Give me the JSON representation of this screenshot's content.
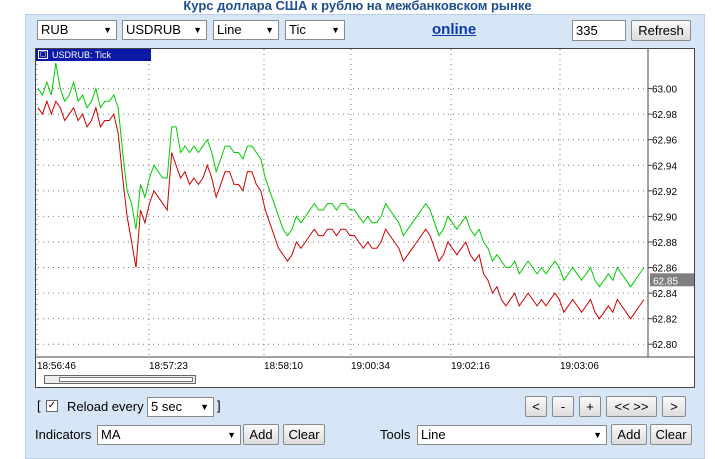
{
  "page_title": "Курс доллара США к рублю на межбанковском рынке",
  "toolbar": {
    "currency": "RUB",
    "pair": "USDRUB",
    "chart_type": "Line",
    "interval": "Tic",
    "online_label": "online",
    "count_value": "335",
    "refresh_label": "Refresh"
  },
  "chart_header": "USDRUB: Tick",
  "current_price_label": "62.85",
  "chart_data": {
    "type": "line",
    "title": "USDRUB: Tick",
    "x_tick_labels": [
      "18:56:46",
      "18:57:23",
      "18:58:10",
      "19:00:34",
      "19:02:16",
      "19:03:06"
    ],
    "y_tick_labels": [
      "63.00",
      "62.98",
      "62.96",
      "62.94",
      "62.92",
      "62.90",
      "62.88",
      "62.86",
      "62.84",
      "62.82",
      "62.80"
    ],
    "ylim": [
      62.79,
      63.02
    ],
    "current_value": 62.85,
    "grid": true,
    "colors": {
      "ask": "#00cc00",
      "bid": "#cc0000",
      "spike": "#5a6a00"
    },
    "series": [
      {
        "values": [
          63.0,
          62.995,
          63.005,
          62.995,
          63.02,
          63.0,
          62.99,
          62.995,
          63.005,
          62.99,
          62.995,
          62.985,
          62.99,
          63.0,
          62.985,
          62.99,
          62.99,
          62.995,
          62.985,
          62.95,
          62.92,
          62.91,
          62.89,
          62.925,
          62.915,
          62.93,
          62.94,
          62.935,
          62.93,
          62.93,
          62.97,
          62.97,
          62.95,
          62.955,
          62.95,
          62.955,
          62.95,
          62.955,
          62.96,
          62.95,
          62.935,
          62.945,
          62.955,
          62.955,
          62.95,
          62.95,
          62.945,
          62.955,
          62.955,
          62.95,
          62.945,
          62.93,
          62.92,
          62.91,
          62.9,
          62.89,
          62.885,
          62.89,
          62.9,
          62.895,
          62.9,
          62.905,
          62.91,
          62.905,
          62.905,
          62.91,
          62.91,
          62.905,
          62.91,
          62.91,
          62.905,
          62.905,
          62.9,
          62.895,
          62.9,
          62.895,
          62.895,
          62.9,
          62.91,
          62.905,
          62.9,
          62.895,
          62.885,
          62.89,
          62.895,
          62.9,
          62.905,
          62.91,
          62.905,
          62.895,
          62.885,
          62.89,
          62.9,
          62.895,
          62.89,
          62.895,
          62.9,
          62.89,
          62.885,
          62.89,
          62.88,
          62.875,
          62.865,
          62.87,
          62.865,
          62.86,
          62.86,
          62.865,
          62.855,
          62.86,
          62.865,
          62.86,
          62.855,
          62.86,
          62.855,
          62.86,
          62.865,
          62.86,
          62.85,
          62.855,
          62.86,
          62.855,
          62.85,
          62.855,
          62.86,
          62.85,
          62.845,
          62.85,
          62.855,
          62.85,
          62.86,
          62.855,
          62.85,
          62.845,
          62.85,
          62.855,
          62.86
        ]
      },
      {
        "values": [
          62.985,
          62.98,
          62.99,
          62.98,
          62.99,
          62.985,
          62.975,
          62.98,
          62.985,
          62.975,
          62.98,
          62.97,
          62.975,
          62.985,
          62.97,
          62.975,
          62.975,
          62.98,
          62.965,
          62.93,
          62.9,
          62.88,
          62.86,
          62.905,
          62.895,
          62.91,
          62.92,
          62.915,
          62.91,
          62.905,
          62.95,
          62.94,
          62.93,
          62.935,
          62.925,
          62.93,
          62.925,
          62.93,
          62.94,
          62.93,
          62.915,
          62.925,
          62.935,
          62.935,
          62.925,
          62.925,
          62.92,
          62.935,
          62.935,
          62.925,
          62.92,
          62.905,
          62.895,
          62.885,
          62.875,
          62.87,
          62.865,
          62.87,
          62.88,
          62.875,
          62.88,
          62.885,
          62.89,
          62.885,
          62.885,
          62.89,
          62.89,
          62.885,
          62.89,
          62.89,
          62.885,
          62.885,
          62.88,
          62.875,
          62.88,
          62.875,
          62.875,
          62.88,
          62.89,
          62.885,
          62.88,
          62.875,
          62.865,
          62.87,
          62.875,
          62.88,
          62.885,
          62.89,
          62.885,
          62.875,
          62.865,
          62.87,
          62.88,
          62.875,
          62.87,
          62.875,
          62.88,
          62.87,
          62.865,
          62.87,
          62.855,
          62.85,
          62.84,
          62.845,
          62.835,
          62.83,
          62.835,
          62.84,
          62.83,
          62.835,
          62.84,
          62.835,
          62.83,
          62.835,
          62.83,
          62.835,
          62.84,
          62.835,
          62.825,
          62.83,
          62.835,
          62.83,
          62.825,
          62.83,
          62.835,
          62.825,
          62.82,
          62.825,
          62.83,
          62.825,
          62.835,
          62.83,
          62.825,
          62.82,
          62.825,
          62.83,
          62.835
        ]
      }
    ]
  },
  "bottom": {
    "reload_checked": true,
    "bracket_open": "[",
    "bracket_close": "]",
    "reload_label": "Reload every",
    "reload_interval": "5 sec",
    "nav_buttons": [
      "<",
      "-",
      "+",
      "<< >>",
      ">"
    ],
    "indicators_label": "Indicators",
    "indicator_value": "MA",
    "indicators_add": "Add",
    "indicators_clear": "Clear",
    "tools_label": "Tools",
    "tool_value": "Line",
    "tools_add": "Add",
    "tools_clear": "Clear"
  }
}
